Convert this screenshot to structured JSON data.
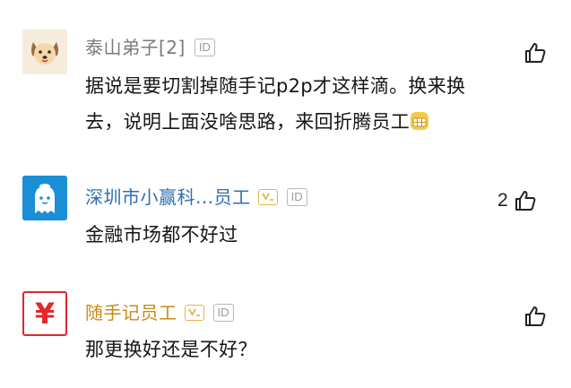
{
  "comments": [
    {
      "username": "泰山弟子[2]",
      "id_badge": "ID",
      "has_v_badge": false,
      "avatar": "dog-avatar-icon",
      "text_lines": [
        "据说是要切割掉随手记p2p才这样滴。换来换",
        "去，说明上面没啥思路，来回折腾员工"
      ],
      "trailing_emoji": "teeth-grin-emoji-icon",
      "likes": ""
    },
    {
      "username": "深圳市小赢科...员工",
      "id_badge": "ID",
      "has_v_badge": true,
      "avatar": "ghost-mascot-avatar-icon",
      "text_lines": [
        "金融市场都不好过"
      ],
      "likes": "2"
    },
    {
      "username": "随手记员工",
      "id_badge": "ID",
      "has_v_badge": true,
      "avatar": "yen-logo-avatar-icon",
      "avatar_symbol": "¥",
      "text_lines": [
        "那更换好还是不好？"
      ],
      "likes": ""
    }
  ],
  "colors": {
    "username_gray": "#7a7a7a",
    "username_blue": "#2f6fb3",
    "username_gold": "#c98a17",
    "text": "#161616",
    "badge_border": "#b8b8b8",
    "v_badge": "#e9b34a",
    "yen_red": "#e0282d"
  },
  "icons": {
    "like": "thumbs-up-icon",
    "id": "id-badge-icon",
    "verified": "v-badge-icon"
  }
}
